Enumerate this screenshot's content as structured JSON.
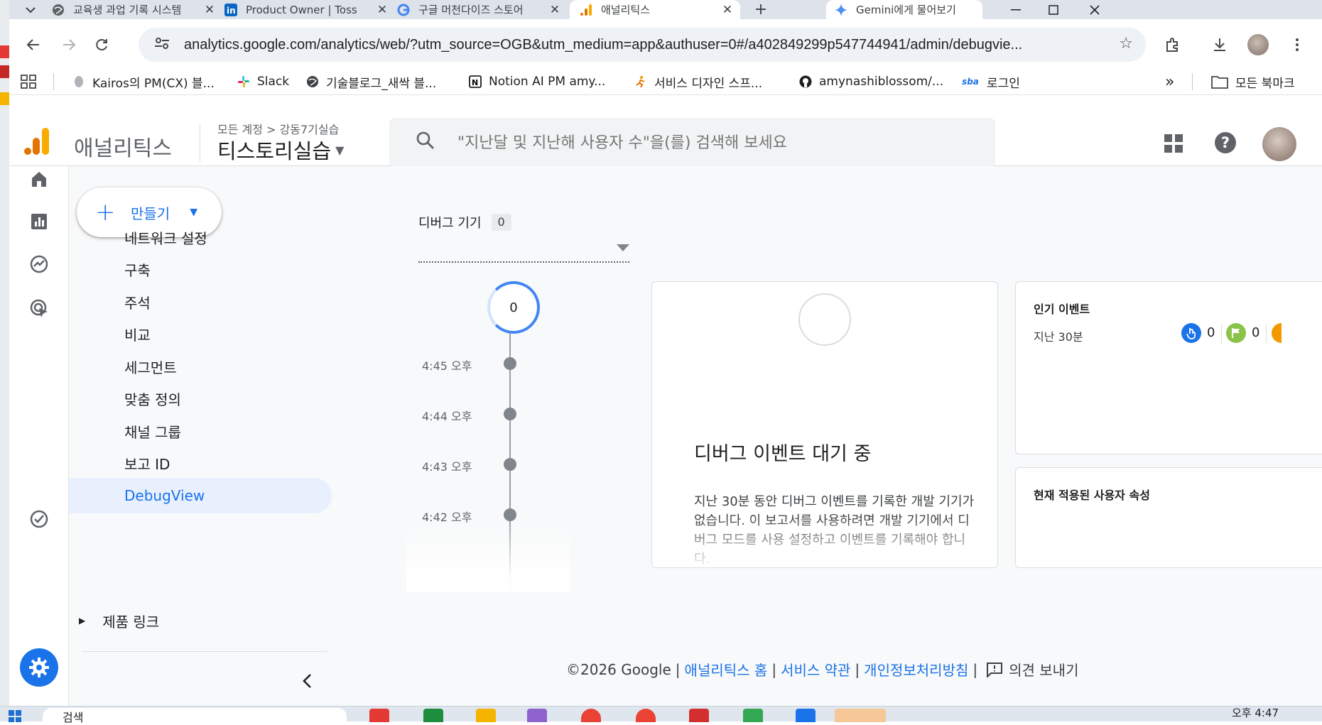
{
  "browser": {
    "tabs": [
      {
        "label": "교육생 과업 기록 시스템",
        "favicon": "globe-icon"
      },
      {
        "label": "Product Owner | Toss",
        "favicon": "linkedin-icon"
      },
      {
        "label": "구글 머천다이즈 스토어",
        "favicon": "google-icon"
      },
      {
        "label": "애널리틱스",
        "favicon": "analytics-icon"
      }
    ],
    "new_tab": "+",
    "gemini_label": "Gemini에게 물어보기",
    "url": "analytics.google.com/analytics/web/?utm_source=OGB&utm_medium=app&authuser=0#/a402849299p547744941/admin/debugvie...",
    "bookmarks": [
      {
        "label": "Kairos의 PM(CX) 블...",
        "icon": "blog-icon"
      },
      {
        "label": "Slack",
        "icon": "slack-icon"
      },
      {
        "label": "기술블로그_새싹 블...",
        "icon": "globe-icon"
      },
      {
        "label": "Notion AI PM amy...",
        "icon": "notion-icon"
      },
      {
        "label": "서비스 디자인 스프...",
        "icon": "runner-icon"
      },
      {
        "label": "amynashiblossom/...",
        "icon": "github-icon"
      },
      {
        "label": "로그인",
        "icon": "sba-icon"
      }
    ],
    "bookmarks_more": "»",
    "all_bookmarks": "모든 북마크"
  },
  "ga": {
    "product": "애널리틱스",
    "breadcrumb_account": "모든 계정",
    "breadcrumb_sep": ">",
    "breadcrumb_property": "강동7기실습",
    "property": "티스토리실습",
    "search_placeholder": "\"지난달 및 지난해 사용자 수\"을(를) 검색해 보세요",
    "help": "?"
  },
  "nav": {
    "create_label": "만들기",
    "items": [
      {
        "label": "네트워크 설정"
      },
      {
        "label": "구축"
      },
      {
        "label": "주석"
      },
      {
        "label": "비교"
      },
      {
        "label": "세그먼트"
      },
      {
        "label": "맞춤 정의"
      },
      {
        "label": "채널 그룹"
      },
      {
        "label": "보고 ID"
      },
      {
        "label": "DebugView"
      }
    ],
    "active_index": 8,
    "product_links": "제품 링크"
  },
  "debug": {
    "device_label": "디버그 기기",
    "device_count": "0",
    "timeline_count": "0",
    "times": [
      "4:45 오후",
      "4:44 오후",
      "4:43 오후",
      "4:42 오후"
    ],
    "waiting_title": "디버그 이벤트 대기 중",
    "waiting_body": "지난 30분 동안 디버그 이벤트를 기록한 개발 기기가 없습니다. 이 보고서를 사용하려면 개발 기기에서 디버그 모드를 사용 설정하고 이벤트를 기록해야 합니다.",
    "top_events_title": "인기 이벤트",
    "top_events_range": "지난 30분",
    "event_counts": [
      "0",
      "0"
    ],
    "user_props_title": "현재 적용된 사용자 속성"
  },
  "footer": {
    "copyright": "©2026 Google",
    "sep": "|",
    "home": "애널리틱스 홈",
    "terms": "서비스 약관",
    "privacy": "개인정보처리방침",
    "feedback": "의견 보내기"
  },
  "taskbar": {
    "search_text": "검색",
    "clock": "오후 4:47"
  },
  "colors": {
    "accent": "#1a73e8",
    "nav_active_bg": "#e8f0fe",
    "event_blue": "#1a73e8",
    "event_green": "#8bc34a"
  }
}
